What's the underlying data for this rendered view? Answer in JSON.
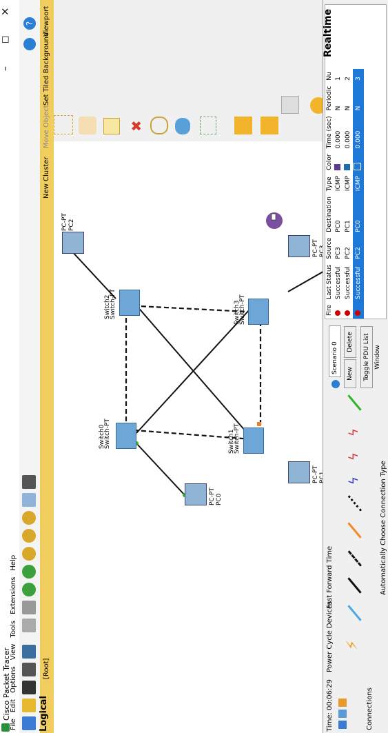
{
  "window": {
    "title": "Cisco Packet Tracer",
    "controls": [
      "–",
      "□",
      "×"
    ]
  },
  "menu": [
    "File",
    "Edit",
    "Options",
    "View",
    "Tools",
    "Extensions",
    "Help"
  ],
  "logical_bar": {
    "tab": "Logical",
    "root": "[Root]",
    "new_cluster": "New Cluster",
    "move_object": "Move Object",
    "set_tiled_background": "Set Tiled Background",
    "viewport": "Viewport"
  },
  "devices": {
    "pc0": {
      "type": "PC-PT",
      "name": "PC0"
    },
    "pc1": {
      "type": "PC-PT",
      "name": "PC1"
    },
    "pc2": {
      "type": "PC-PT",
      "name": "PC2"
    },
    "pc3": {
      "type": "PC-PT",
      "name": "PC3"
    },
    "sw0": {
      "type": "Switch-PT",
      "name": "Switch0"
    },
    "sw1": {
      "type": "Switch-PT",
      "name": "Switch1"
    },
    "sw2": {
      "type": "Switch-PT",
      "name": "Switch2"
    },
    "sw3": {
      "type": "Switch-PT",
      "name": "Switch3"
    }
  },
  "status": {
    "time": "Time: 00:06:29",
    "power_cycle": "Power Cycle Devices",
    "fast_forward": "Fast Forward Time"
  },
  "connections": {
    "category_label": "Connections",
    "hint": "Automatically Choose Connection Type"
  },
  "realtime": "Realtime",
  "scenario": {
    "selected": "Scenario 0",
    "new_label": "New",
    "delete_label": "Delete",
    "toggle_label": "Toggle PDU List Window"
  },
  "pdu_table": {
    "headers": [
      "Fire",
      "Last Status",
      "Source",
      "Destination",
      "Type",
      "Color",
      "Time (sec)",
      "Periodic",
      "Nu"
    ],
    "rows": [
      {
        "status": "Successful",
        "source": "PC3",
        "dest": "PC0",
        "type": "ICMP",
        "color": "#5b3c8c",
        "time": "0.000",
        "periodic": "N",
        "num": "1"
      },
      {
        "status": "Successful",
        "source": "PC2",
        "dest": "PC1",
        "type": "ICMP",
        "color": "#1e6fa8",
        "time": "0.000",
        "periodic": "N",
        "num": "2"
      },
      {
        "status": "Successful",
        "source": "PC2",
        "dest": "PC0",
        "type": "ICMP",
        "color": "#1e78d8",
        "time": "0.000",
        "periodic": "N",
        "num": "3"
      }
    ]
  },
  "colors": {
    "accent_bar": "#f1cd5e",
    "pdu_envelope": "#7a4fa0",
    "selected_row": "#1e78d8",
    "link_light": "#2bb52b"
  }
}
